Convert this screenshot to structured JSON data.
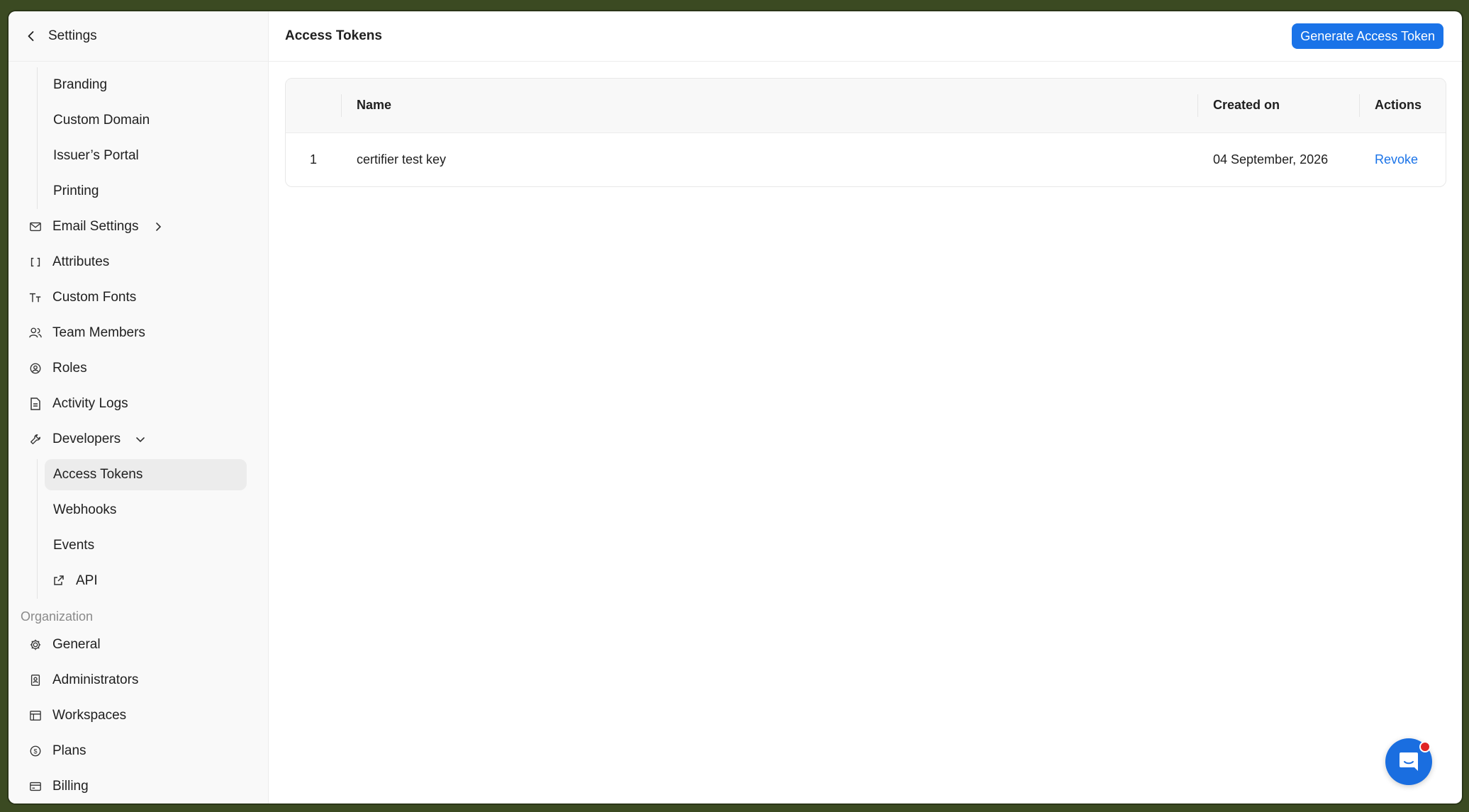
{
  "sidebar": {
    "back_label": "Settings",
    "sub_items_top": [
      {
        "label": "Branding"
      },
      {
        "label": "Custom Domain"
      },
      {
        "label": "Issuer’s Portal"
      },
      {
        "label": "Printing"
      }
    ],
    "items": [
      {
        "label": "Email Settings",
        "icon": "mail-icon"
      },
      {
        "label": "Attributes",
        "icon": "brackets-icon"
      },
      {
        "label": "Custom Fonts",
        "icon": "text-type-icon"
      },
      {
        "label": "Team Members",
        "icon": "team-icon"
      },
      {
        "label": "Roles",
        "icon": "role-icon"
      },
      {
        "label": "Activity Logs",
        "icon": "document-icon"
      },
      {
        "label": "Developers",
        "icon": "wrench-icon"
      }
    ],
    "developer_items": [
      {
        "label": "Access Tokens"
      },
      {
        "label": "Webhooks"
      },
      {
        "label": "Events"
      },
      {
        "label": "API",
        "icon": "external-link-icon"
      }
    ],
    "org_section_label": "Organization",
    "org_items": [
      {
        "label": "General",
        "icon": "gear-icon"
      },
      {
        "label": "Administrators",
        "icon": "badge-icon"
      },
      {
        "label": "Workspaces",
        "icon": "layout-icon"
      },
      {
        "label": "Plans",
        "icon": "dollar-circle-icon"
      },
      {
        "label": "Billing",
        "icon": "card-icon"
      }
    ]
  },
  "header": {
    "title": "Access Tokens",
    "generate_button": "Generate Access Token"
  },
  "table": {
    "columns": [
      "",
      "Name",
      "Created on",
      "Actions"
    ],
    "rows": [
      {
        "index": "1",
        "name": "certifier test key",
        "created_on": "04 September, 2026",
        "action": "Revoke"
      }
    ]
  },
  "colors": {
    "accent": "#1a73e8",
    "notification": "#e02424"
  }
}
